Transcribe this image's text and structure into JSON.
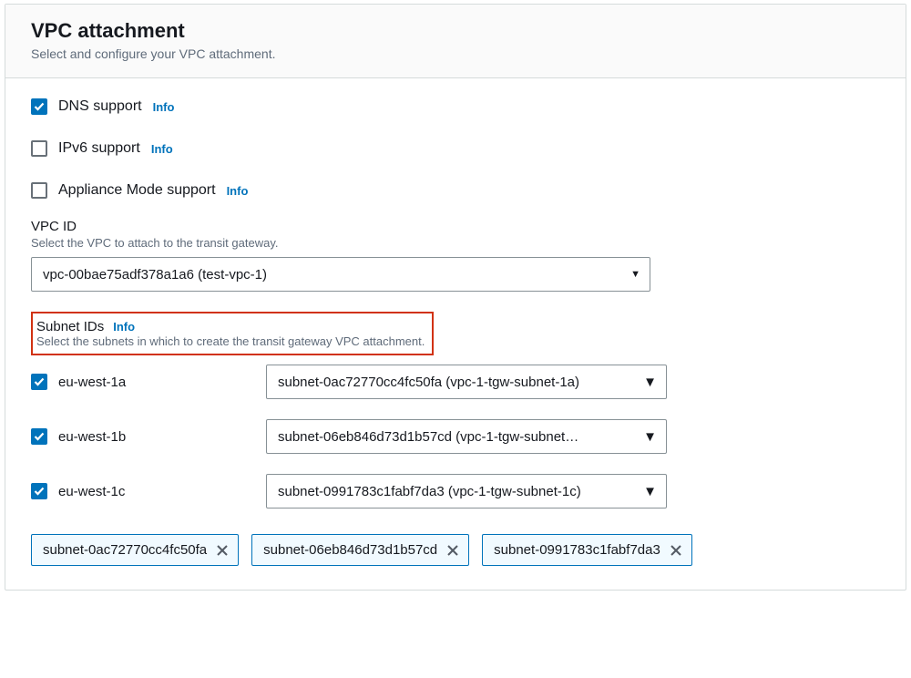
{
  "header": {
    "title": "VPC attachment",
    "subtitle": "Select and configure your VPC attachment."
  },
  "info_label": "Info",
  "checkboxes": {
    "dns": {
      "label": "DNS support",
      "checked": true
    },
    "ipv6": {
      "label": "IPv6 support",
      "checked": false
    },
    "appl": {
      "label": "Appliance Mode support",
      "checked": false
    }
  },
  "vpc": {
    "label": "VPC ID",
    "hint": "Select the VPC to attach to the transit gateway.",
    "selected": "vpc-00bae75adf378a1a6 (test-vpc-1)"
  },
  "subnets": {
    "label": "Subnet IDs",
    "hint": "Select the subnets in which to create the transit gateway VPC attachment.",
    "rows": [
      {
        "az": "eu-west-1a",
        "subnet": "subnet-0ac72770cc4fc50fa (vpc-1-tgw-subnet-1a)",
        "checked": true
      },
      {
        "az": "eu-west-1b",
        "subnet": "subnet-06eb846d73d1b57cd (vpc-1-tgw-subnet…",
        "checked": true
      },
      {
        "az": "eu-west-1c",
        "subnet": "subnet-0991783c1fabf7da3 (vpc-1-tgw-subnet-1c)",
        "checked": true
      }
    ]
  },
  "tags": [
    "subnet-0ac72770cc4fc50fa",
    "subnet-06eb846d73d1b57cd",
    "subnet-0991783c1fabf7da3"
  ]
}
